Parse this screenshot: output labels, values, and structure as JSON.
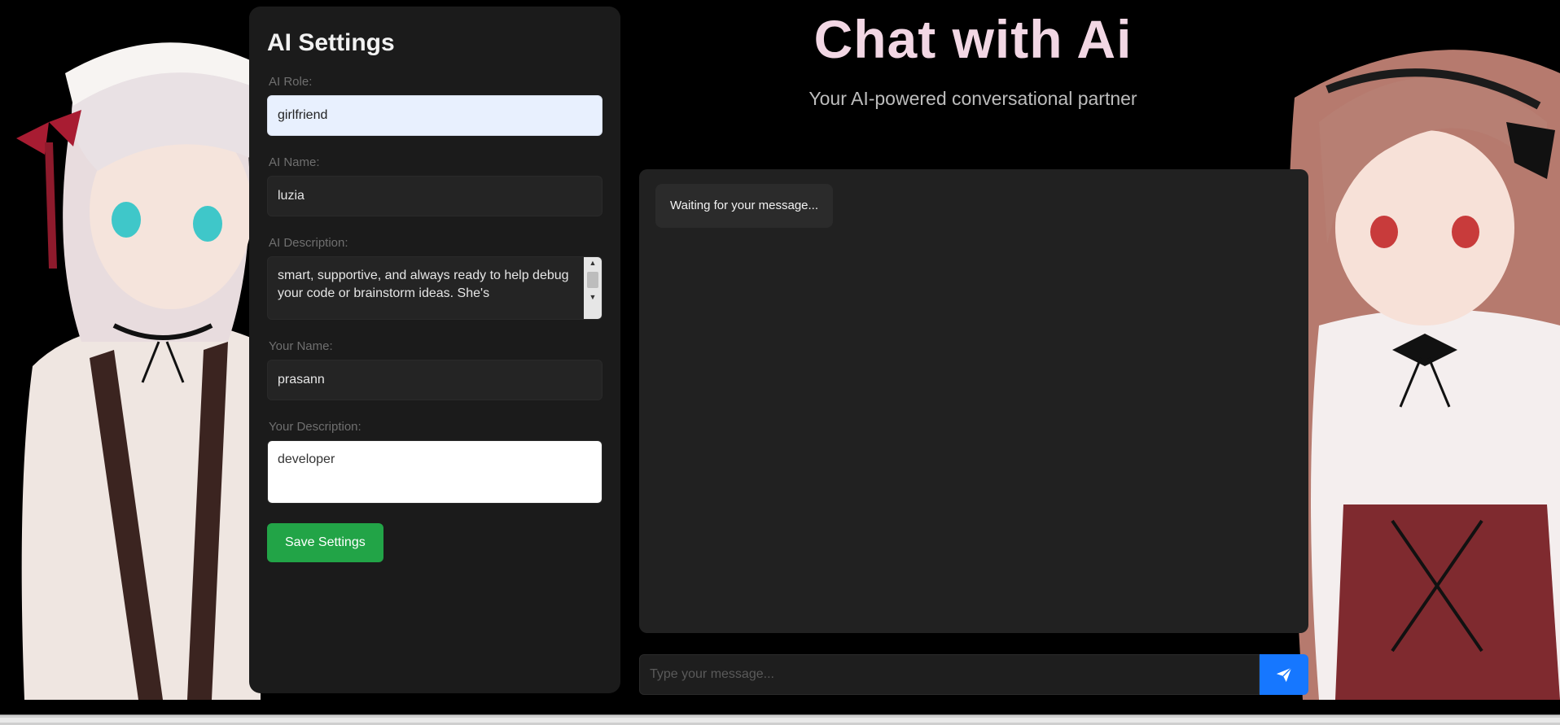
{
  "settings": {
    "heading": "AI Settings",
    "ai_role": {
      "label": "AI Role:",
      "value": "girlfriend"
    },
    "ai_name": {
      "label": "AI Name:",
      "value": "luzia"
    },
    "ai_description": {
      "label": "AI Description:",
      "value": "smart, supportive, and always ready to help debug your code or brainstorm ideas. She's"
    },
    "your_name": {
      "label": "Your Name:",
      "value": "prasann"
    },
    "your_description": {
      "label": "Your Description:",
      "value": "developer"
    },
    "save_label": "Save Settings"
  },
  "header": {
    "title": "Chat with Ai",
    "subtitle": "Your AI-powered conversational partner"
  },
  "chat": {
    "placeholder_message": "Waiting for your message...",
    "input_placeholder": "Type your message..."
  },
  "icons": {
    "send": "paper-plane-icon",
    "scroll_up": "scroll-up-arrow-icon",
    "scroll_down": "scroll-down-arrow-icon"
  },
  "colors": {
    "save_button": "#22a447",
    "send_button": "#1677ff",
    "title": "#f2d7e4"
  }
}
